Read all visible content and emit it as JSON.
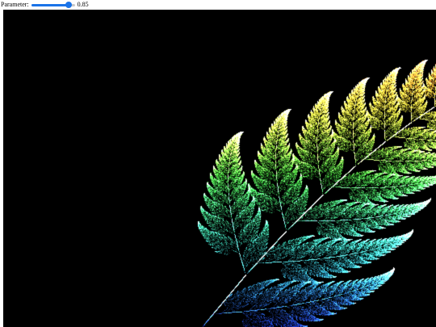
{
  "controls": {
    "parameter_label": "Parameter:",
    "parameter_value": "0.85",
    "slider": {
      "min": 0,
      "max": 1,
      "value": 0.85
    }
  },
  "canvas": {
    "background": "#000000",
    "fractal": "barnsley-fern",
    "coloring": [
      "#1a2fb0",
      "#2fa8a0",
      "#3fbf3a",
      "#c8b030",
      "#e22222"
    ]
  },
  "colors": {
    "slider_accent": "#1a73e8",
    "slider_track": "#c8c8c8"
  }
}
